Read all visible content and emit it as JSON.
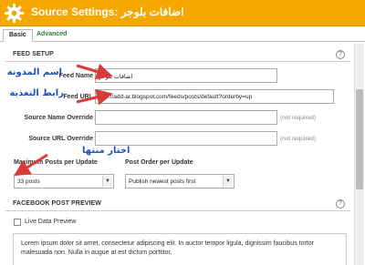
{
  "window": {
    "title": "Source Settings: اضافات بلوجر"
  },
  "tabs": {
    "basic": "Basic",
    "advanced": "Advanced"
  },
  "feed_setup": {
    "section_title": "FEED SETUP",
    "help": "?",
    "feed_name_label": "Feed Name",
    "feed_name_value": "اضافات بلوجر",
    "feed_url_label": "Feed URL",
    "feed_url_value": "http://add-ar.blogspot.com/feeds/posts/default?orderby=up",
    "source_name_override_label": "Source Name Override",
    "source_name_override_value": "",
    "source_url_override_label": "Source URL Override",
    "source_url_override_value": "",
    "not_required_1": "(not required)",
    "not_required_2": "(not required)",
    "max_posts_label": "Maximum Posts per Update",
    "max_posts_value": "33 posts",
    "post_order_label": "Post Order per Update",
    "post_order_value": "Publish newest posts first"
  },
  "preview": {
    "section_title": "FACEBOOK POST PREVIEW",
    "help": "?",
    "live_data_label": "Live Data Preview",
    "body_text": "Lorem ipsum dolor sit amet, consectetur adipiscing elit. In auctor tempor ligula, dignissim faucibus tortor malesuada non. Nulla in augue at est dictum porttitor."
  },
  "annotations": {
    "blog_name": "اسم المدونة",
    "feed_link": "رابط التغذية",
    "choose_posts": "اختار منتها"
  },
  "colors": {
    "titlebar": "#f5a700",
    "annotation": "#1f4fbf",
    "arrow": "#d93a3a",
    "advanced_tab": "#2e7d32"
  }
}
